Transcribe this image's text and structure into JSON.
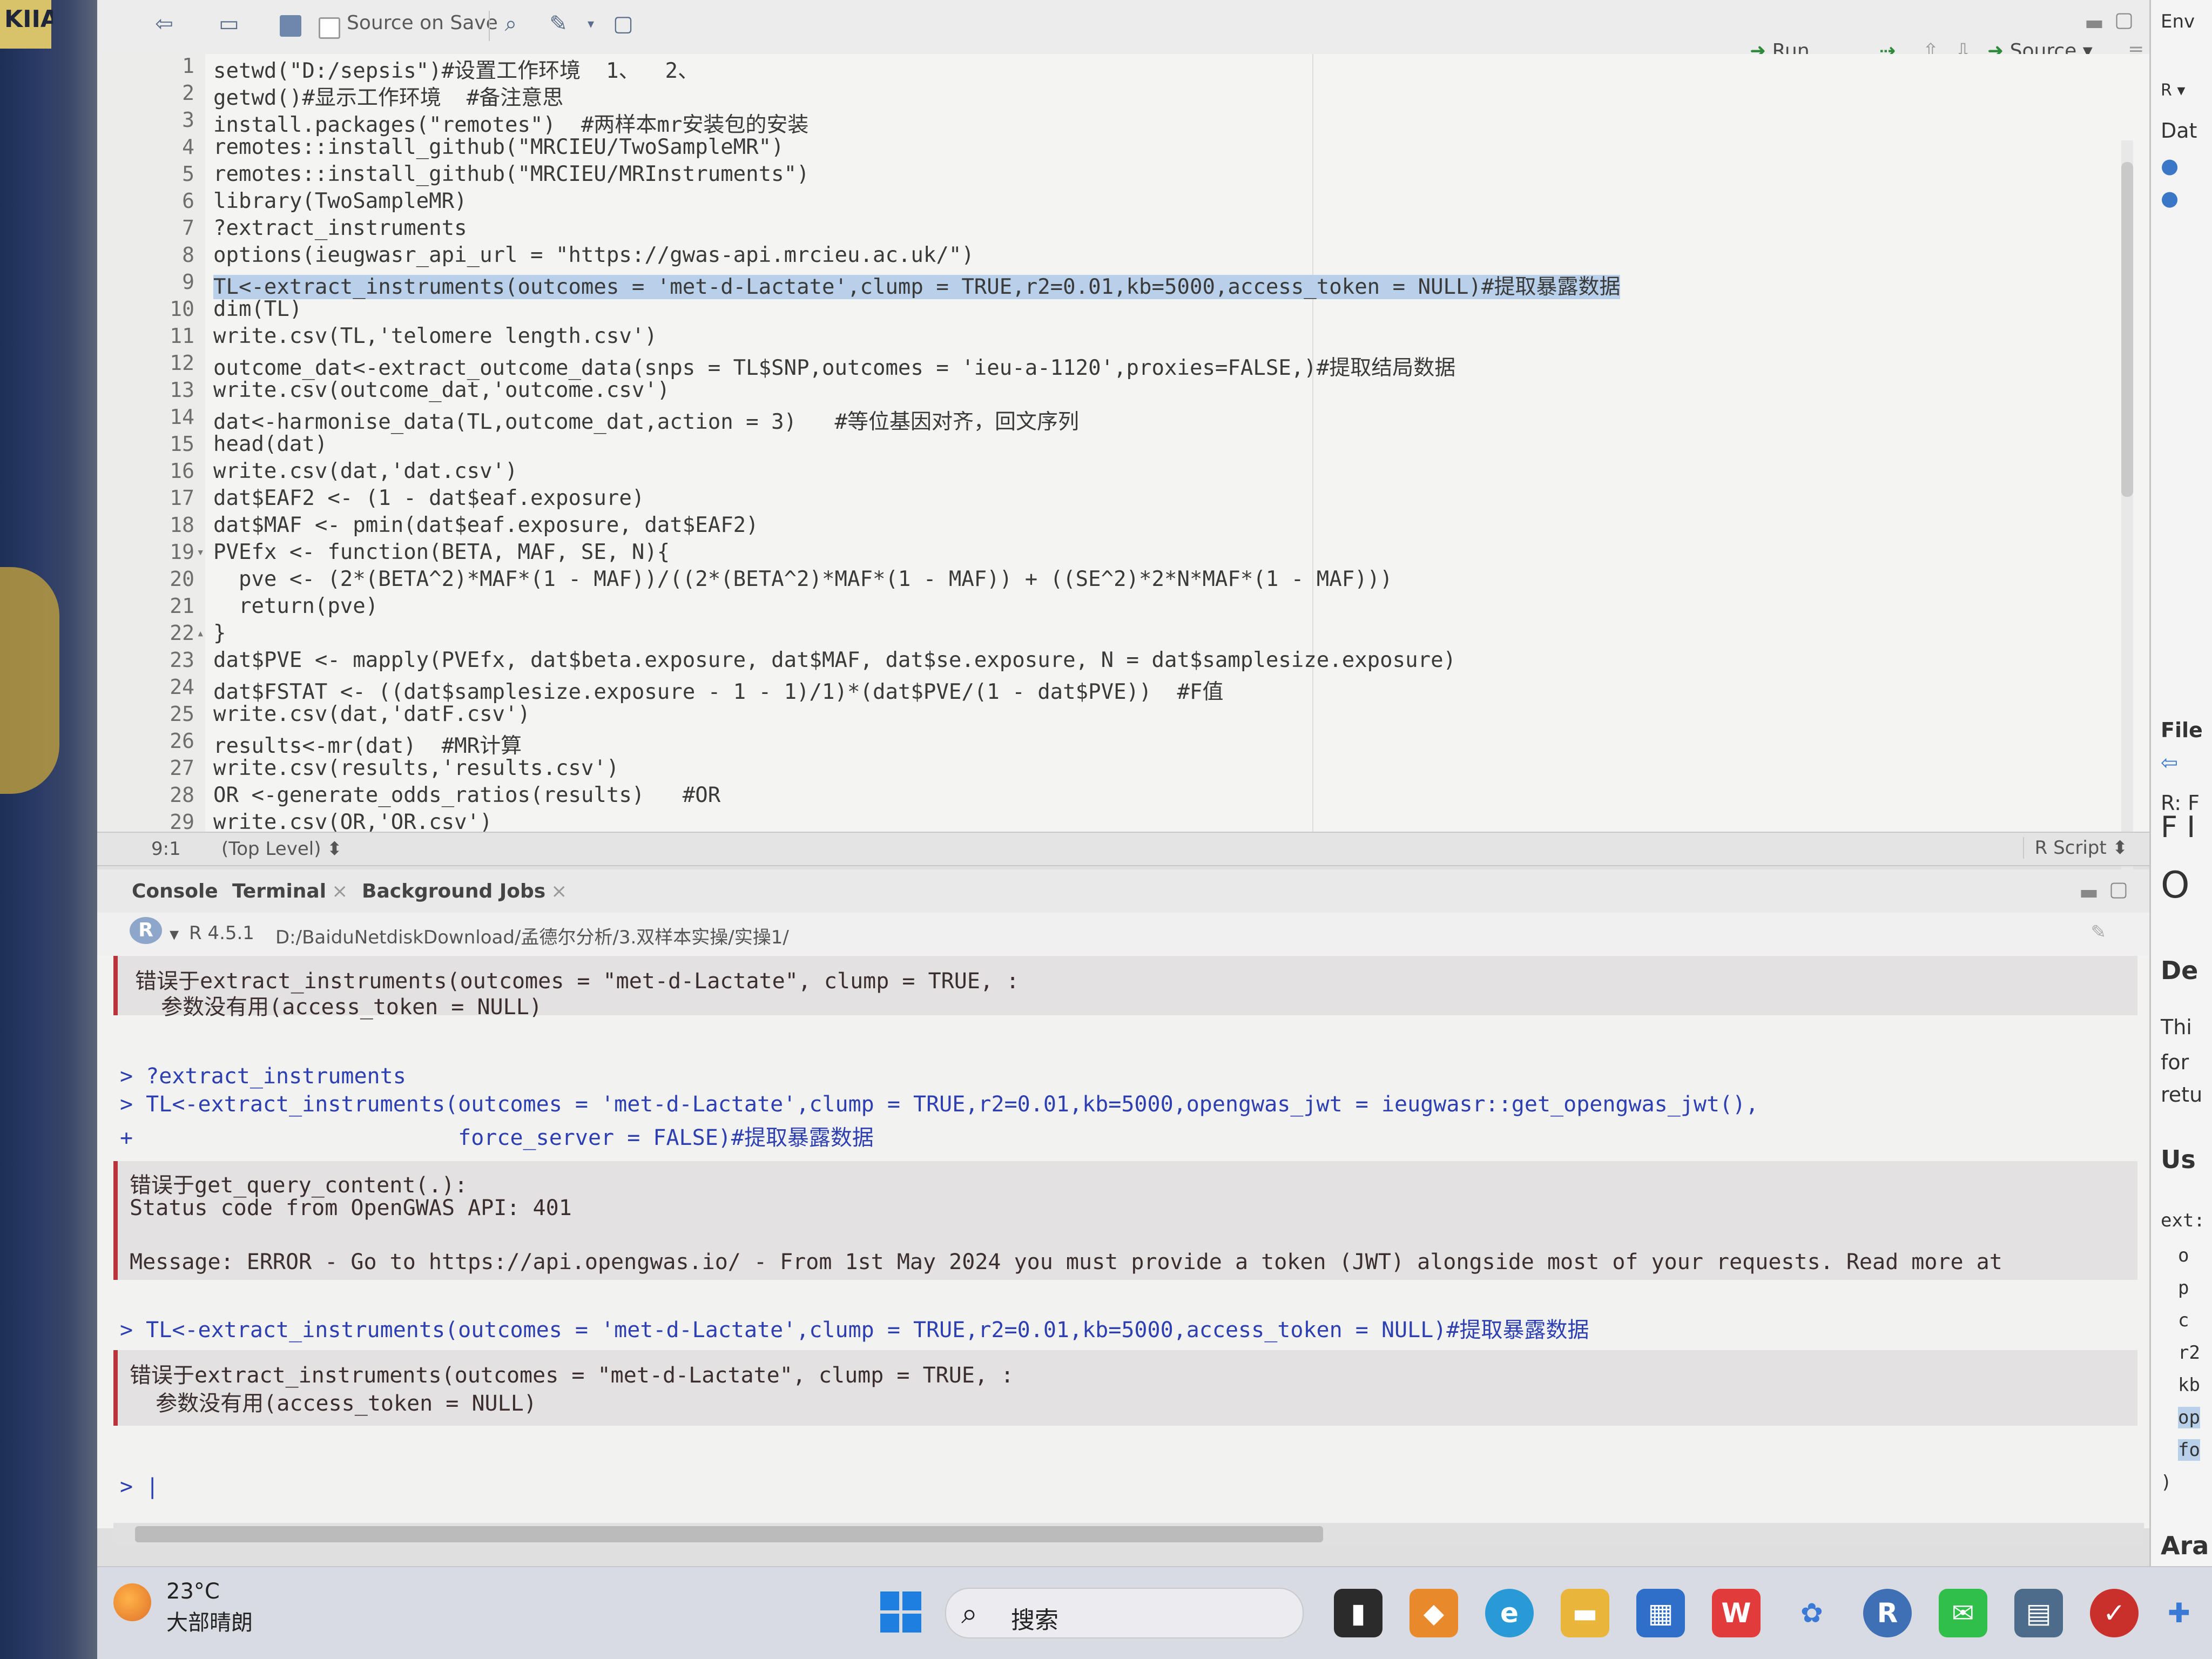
{
  "left_frame": {
    "label": "KIIAC"
  },
  "toolbar": {
    "source_on_save": "Source on Save",
    "run": "Run",
    "source": "Source"
  },
  "editor": {
    "lines": [
      {
        "n": "1",
        "text": "setwd(\"D:/sepsis\")#设置工作环境  1、  2、"
      },
      {
        "n": "2",
        "text": "getwd()#显示工作环境  #备注意思"
      },
      {
        "n": "3",
        "text": "install.packages(\"remotes\")  #两样本mr安装包的安装"
      },
      {
        "n": "4",
        "text": "remotes::install_github(\"MRCIEU/TwoSampleMR\")"
      },
      {
        "n": "5",
        "text": "remotes::install_github(\"MRCIEU/MRInstruments\")"
      },
      {
        "n": "6",
        "text": "library(TwoSampleMR)"
      },
      {
        "n": "7",
        "text": "?extract_instruments"
      },
      {
        "n": "8",
        "text": "options(ieugwasr_api_url = \"https://gwas-api.mrcieu.ac.uk/\")"
      },
      {
        "n": "9",
        "text": "TL<-extract_instruments(outcomes = 'met-d-Lactate',clump = TRUE,r2=0.01,kb=5000,access_token = NULL)#提取暴露数据"
      },
      {
        "n": "10",
        "text": "dim(TL)"
      },
      {
        "n": "11",
        "text": "write.csv(TL,'telomere length.csv')"
      },
      {
        "n": "12",
        "text": "outcome_dat<-extract_outcome_data(snps = TL$SNP,outcomes = 'ieu-a-1120',proxies=FALSE,)#提取结局数据"
      },
      {
        "n": "13",
        "text": "write.csv(outcome_dat,'outcome.csv')"
      },
      {
        "n": "14",
        "text": "dat<-harmonise_data(TL,outcome_dat,action = 3)   #等位基因对齐，回文序列"
      },
      {
        "n": "15",
        "text": "head(dat)"
      },
      {
        "n": "16",
        "text": "write.csv(dat,'dat.csv')"
      },
      {
        "n": "17",
        "text": "dat$EAF2 <- (1 - dat$eaf.exposure)"
      },
      {
        "n": "18",
        "text": "dat$MAF <- pmin(dat$eaf.exposure, dat$EAF2)"
      },
      {
        "n": "19",
        "text": "PVEfx <- function(BETA, MAF, SE, N){"
      },
      {
        "n": "20",
        "text": "  pve <- (2*(BETA^2)*MAF*(1 - MAF))/((2*(BETA^2)*MAF*(1 - MAF)) + ((SE^2)*2*N*MAF*(1 - MAF)))"
      },
      {
        "n": "21",
        "text": "  return(pve)"
      },
      {
        "n": "22",
        "text": "}"
      },
      {
        "n": "23",
        "text": "dat$PVE <- mapply(PVEfx, dat$beta.exposure, dat$MAF, dat$se.exposure, N = dat$samplesize.exposure)"
      },
      {
        "n": "24",
        "text": "dat$FSTAT <- ((dat$samplesize.exposure - 1 - 1)/1)*(dat$PVE/(1 - dat$PVE))  #F值"
      },
      {
        "n": "25",
        "text": "write.csv(dat,'datF.csv')"
      },
      {
        "n": "26",
        "text": "results<-mr(dat)  #MR计算"
      },
      {
        "n": "27",
        "text": "write.csv(results,'results.csv')"
      },
      {
        "n": "28",
        "text": "OR <-generate_odds_ratios(results)   #OR"
      },
      {
        "n": "29",
        "text": "write.csv(OR,'OR.csv')"
      }
    ],
    "cursor_pos": "9:1",
    "scope": "(Top Level) ⬍",
    "file_type": "R Script ⬍"
  },
  "console": {
    "tabs": [
      {
        "label": "Console"
      },
      {
        "label": "Terminal"
      },
      {
        "label": "Background Jobs"
      }
    ],
    "r_version": "R 4.5.1",
    "path": "D:/BaiduNetdiskDownload/孟德尔分析/3.双样本实操/实操1/",
    "lines": [
      "错误于extract_instruments(outcomes = \"met-d-Lactate\", clump = TRUE, :",
      "  参数没有用(access_token = NULL)",
      "> ?extract_instruments",
      "> TL<-extract_instruments(outcomes = 'met-d-Lactate',clump = TRUE,r2=0.01,kb=5000,opengwas_jwt = ieugwasr::get_opengwas_jwt(),",
      "+                         force_server = FALSE)#提取暴露数据",
      "错误于get_query_content(.):",
      "Status code from OpenGWAS API: 401",
      "Message: ERROR - Go to https://api.opengwas.io/ - From 1st May 2024 you must provide a token (JWT) alongside most of your requests. Read more at",
      "> TL<-extract_instruments(outcomes = 'met-d-Lactate',clump = TRUE,r2=0.01,kb=5000,access_token = NULL)#提取暴露数据",
      "错误于extract_instruments(outcomes = \"met-d-Lactate\", clump = TRUE, :",
      "  参数没有用(access_token = NULL)",
      "> |"
    ]
  },
  "right_pane": {
    "env": "Env",
    "r": "R ▾",
    "dat": "Dat",
    "files": "File",
    "rf": "R: F",
    "fl": "F I",
    "o": "O",
    "de": "De",
    "thi": "Thi",
    "for": "for",
    "ret": "retu",
    "us": "Us",
    "ext": "ext:",
    "o2": "o",
    "p": "p",
    "c": "c",
    "r2": "r2",
    "kb": "kb",
    "op": "op",
    "fo": "fo",
    "paren": ")",
    "ara": "Ara"
  },
  "taskbar": {
    "temp": "23°C",
    "weather": "大部晴朗",
    "search": "搜索"
  },
  "colors": {
    "selection": "#b9d0ea",
    "error_border": "#b8343a",
    "keyword": "#2e3fb0"
  }
}
